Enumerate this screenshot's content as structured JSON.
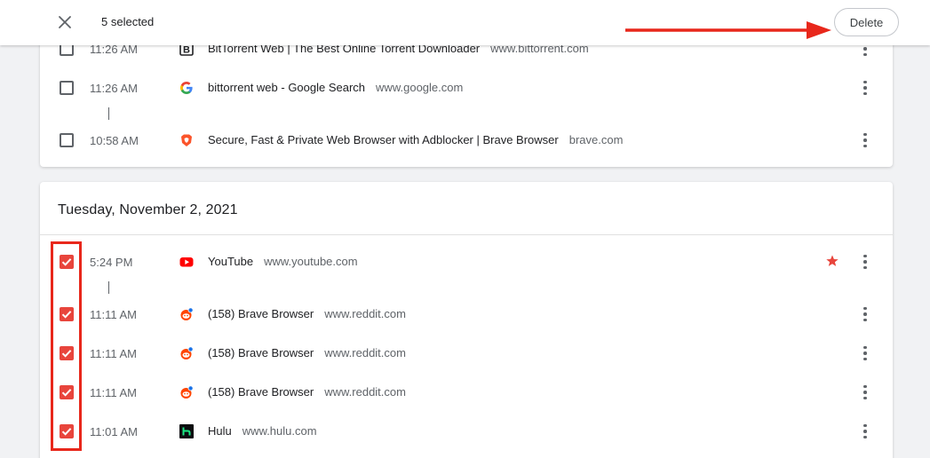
{
  "toolbar": {
    "selected_label": "5 selected",
    "delete_label": "Delete"
  },
  "colors": {
    "accent": "#e8453c",
    "annotation": "#e8271b"
  },
  "group1": {
    "items": [
      {
        "checked": false,
        "time": "11:26 AM",
        "favicon": "bittorrent-icon",
        "title": "BitTorrent Web | The Best Online Torrent Downloader",
        "domain": "www.bittorrent.com"
      },
      {
        "checked": false,
        "time": "11:26 AM",
        "favicon": "google-icon",
        "title": "bittorrent web - Google Search",
        "domain": "www.google.com"
      },
      {
        "checked": false,
        "time": "10:58 AM",
        "favicon": "brave-icon",
        "title": "Secure, Fast & Private Web Browser with Adblocker | Brave Browser",
        "domain": "brave.com"
      }
    ]
  },
  "group2": {
    "date": "Tuesday, November 2, 2021",
    "items": [
      {
        "checked": true,
        "time": "5:24 PM",
        "favicon": "youtube-icon",
        "title": "YouTube",
        "domain": "www.youtube.com",
        "starred": true
      },
      {
        "checked": true,
        "time": "11:11 AM",
        "favicon": "reddit-icon",
        "title": "(158) Brave Browser",
        "domain": "www.reddit.com"
      },
      {
        "checked": true,
        "time": "11:11 AM",
        "favicon": "reddit-icon",
        "title": "(158) Brave Browser",
        "domain": "www.reddit.com"
      },
      {
        "checked": true,
        "time": "11:11 AM",
        "favicon": "reddit-icon",
        "title": "(158) Brave Browser",
        "domain": "www.reddit.com"
      },
      {
        "checked": true,
        "time": "11:01 AM",
        "favicon": "hulu-icon",
        "title": "Hulu",
        "domain": "www.hulu.com"
      }
    ]
  }
}
